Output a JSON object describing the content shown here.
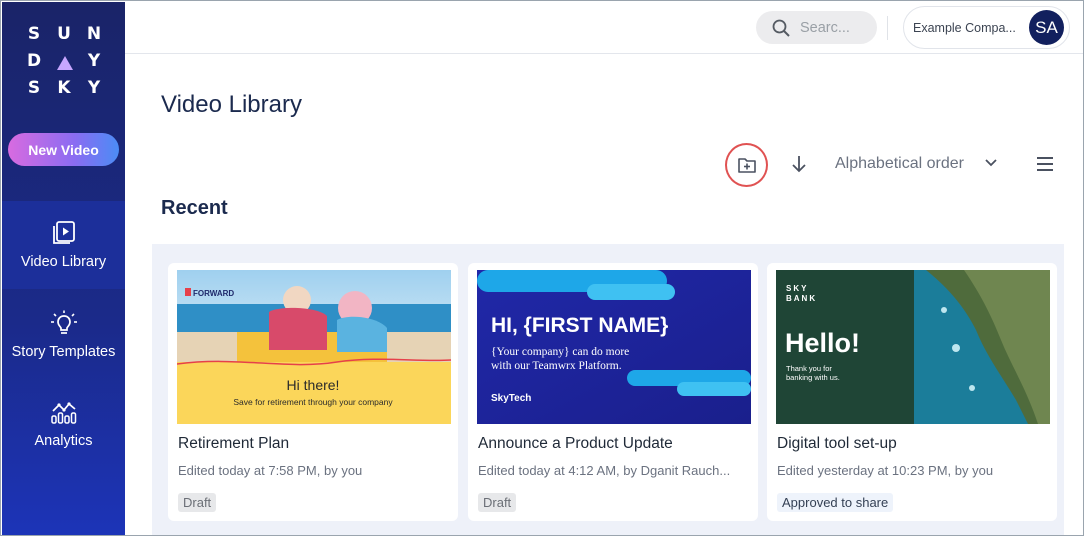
{
  "sidebar": {
    "logo": [
      [
        "S",
        "U",
        "N"
      ],
      [
        "D",
        "",
        "Y"
      ],
      [
        "S",
        "K",
        "Y"
      ]
    ],
    "new_video_label": "New Video",
    "items": [
      {
        "label": "Video Library",
        "icon": "video-library-icon",
        "active": true
      },
      {
        "label": "Story Templates",
        "icon": "lightbulb-icon",
        "active": false
      },
      {
        "label": "Analytics",
        "icon": "analytics-icon",
        "active": false
      }
    ]
  },
  "header": {
    "search_placeholder": "Search...",
    "search_display": "Searc...",
    "account_name": "Example Compa...",
    "avatar_initials": "SA"
  },
  "main": {
    "title": "Video Library",
    "sort_label": "Alphabetical order",
    "section_title": "Recent"
  },
  "cards": [
    {
      "title": "Retirement Plan",
      "meta": "Edited today at 7:58 PM, by you",
      "status": "Draft",
      "thumb": {
        "brand": "FORWARD",
        "headline": "Hi there!",
        "sub": "Save for retirement through your company"
      }
    },
    {
      "title": "Announce a Product Update",
      "meta": "Edited today at 4:12 AM, by Dganit Rauch...",
      "status": "Draft",
      "thumb": {
        "headline": "HI, {FIRST NAME}",
        "sub1": "{Your company} can do more",
        "sub2": "with our Teamwrx Platform.",
        "brand": "SkyTech"
      }
    },
    {
      "title": "Digital tool set-up",
      "meta": "Edited yesterday at 10:23 PM, by you",
      "status": "Approved to share",
      "thumb": {
        "brand1": "SKY",
        "brand2": "BANK",
        "headline": "Hello!",
        "sub1": "Thank you for",
        "sub2": "banking with us."
      }
    }
  ],
  "colors": {
    "sidebar": "#1b2a8a",
    "accent_circle": "#e05252",
    "panel": "#eef1f9",
    "avatar": "#12205e"
  }
}
